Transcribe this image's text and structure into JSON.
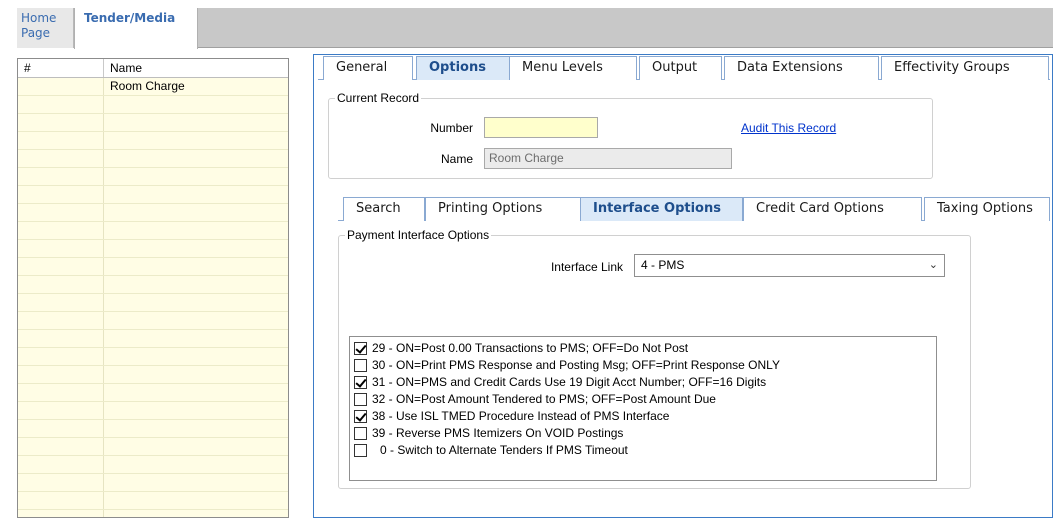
{
  "top_tabs": {
    "home_line1": "Home",
    "home_line2": "Page",
    "active": "Tender/Media"
  },
  "grid": {
    "headers": [
      "#",
      "Name"
    ],
    "rows": [
      {
        "num": "",
        "name": "Room Charge"
      }
    ]
  },
  "main_tabs": [
    "General",
    "Options",
    "Menu Levels",
    "Output",
    "Data Extensions",
    "Effectivity Groups"
  ],
  "current_record": {
    "title": "Current Record",
    "number_label": "Number",
    "number_value": "",
    "name_label": "Name",
    "name_value": "Room Charge",
    "audit_link": "Audit This Record"
  },
  "sub_tabs": [
    "Search",
    "Printing Options",
    "Interface Options",
    "Credit Card Options",
    "Taxing Options"
  ],
  "payment_interface": {
    "title": "Payment Interface Options",
    "link_label": "Interface Link",
    "link_value": "4 - PMS",
    "options": [
      {
        "checked": true,
        "label": "29 - ON=Post 0.00 Transactions to PMS; OFF=Do Not Post"
      },
      {
        "checked": false,
        "label": "30 - ON=Print PMS Response and Posting Msg; OFF=Print Response ONLY"
      },
      {
        "checked": true,
        "label": "31 - ON=PMS and Credit Cards Use 19 Digit Acct Number; OFF=16 Digits"
      },
      {
        "checked": false,
        "label": "32 - ON=Post Amount Tendered to PMS; OFF=Post Amount Due"
      },
      {
        "checked": true,
        "label": "38 - Use ISL TMED Procedure Instead of PMS Interface"
      },
      {
        "checked": false,
        "label": "39 - Reverse PMS Itemizers On VOID Postings"
      },
      {
        "checked": false,
        "label": "0 - Switch to Alternate Tenders If PMS Timeout"
      }
    ]
  },
  "colors": {
    "grid_bg": "#fffde5",
    "tab_active_bg": "#dbe9f8",
    "panel_border": "#3b7bc6",
    "link": "#0033cc",
    "number_field_bg": "#ffffcc"
  }
}
